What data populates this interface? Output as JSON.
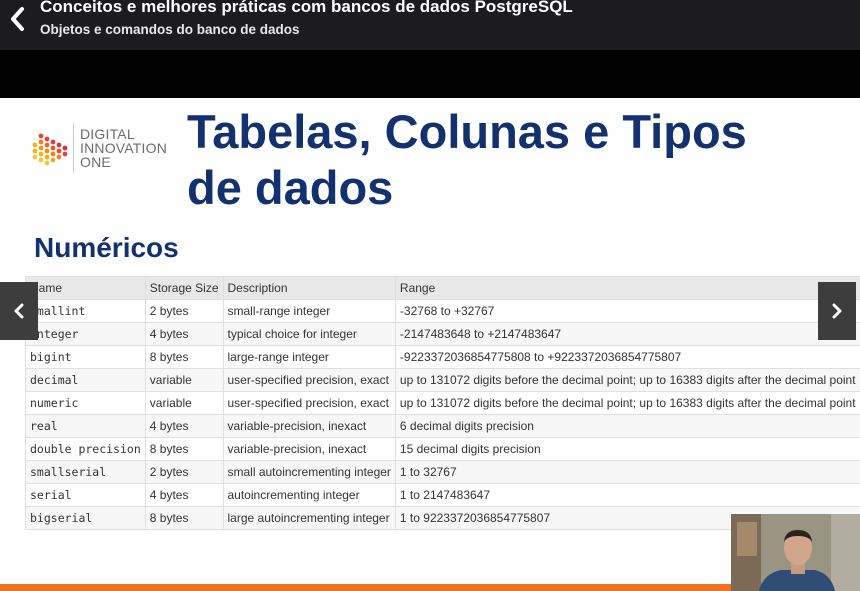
{
  "header": {
    "course_title": "Conceitos e melhores práticas com bancos de dados PostgreSQL",
    "lesson_title": "Objetos e comandos do banco de dados"
  },
  "slide": {
    "logo": {
      "line1": "DIGITAL",
      "line2": "INNOVATION",
      "line3": "ONE"
    },
    "title_line1": "Tabelas, Colunas e Tipos",
    "title_line2": "de dados",
    "subtitle": "Numéricos",
    "table": {
      "headers": [
        "Name",
        "Storage Size",
        "Description",
        "Range"
      ],
      "rows": [
        [
          "smallint",
          "2 bytes",
          "small-range integer",
          "-32768 to +32767"
        ],
        [
          "integer",
          "4 bytes",
          "typical choice for integer",
          "-2147483648 to +2147483647"
        ],
        [
          "bigint",
          "8 bytes",
          "large-range integer",
          "-9223372036854775808 to +9223372036854775807"
        ],
        [
          "decimal",
          "variable",
          "user-specified precision, exact",
          "up to 131072 digits before the decimal point; up to 16383 digits after the decimal point"
        ],
        [
          "numeric",
          "variable",
          "user-specified precision, exact",
          "up to 131072 digits before the decimal point; up to 16383 digits after the decimal point"
        ],
        [
          "real",
          "4 bytes",
          "variable-precision, inexact",
          "6 decimal digits precision"
        ],
        [
          "double precision",
          "8 bytes",
          "variable-precision, inexact",
          "15 decimal digits precision"
        ],
        [
          "smallserial",
          "2 bytes",
          "small autoincrementing integer",
          "1 to 32767"
        ],
        [
          "serial",
          "4 bytes",
          "autoincrementing integer",
          "1 to 2147483647"
        ],
        [
          "bigserial",
          "8 bytes",
          "large autoincrementing integer",
          "1 to 9223372036854775807"
        ]
      ]
    }
  },
  "colors": {
    "title_blue": "#13316e",
    "accent_orange": "#f37021",
    "topbar": "#1c1c1e",
    "nav_button": "#3d3d3d"
  },
  "icons": {
    "back": "chevron-left-icon",
    "prev": "chevron-left-icon",
    "next": "chevron-right-icon"
  }
}
